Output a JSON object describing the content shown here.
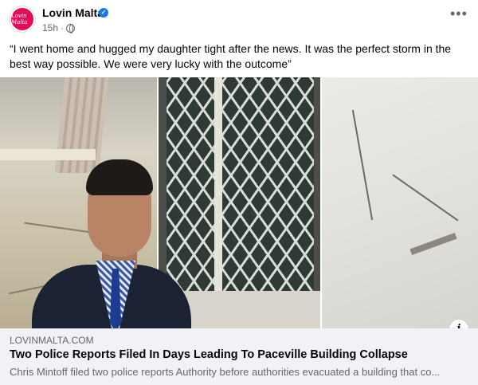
{
  "post": {
    "page_name": "Lovin Malta",
    "avatar_logo_text": "Lovin Malta",
    "time": "15h",
    "privacy_icon": "globe-icon",
    "more_icon": "more-options-icon",
    "caption": "“I went home and hugged my daughter tight after the news. It was the perfect storm in the best way possible. We were very lucky with the outcome”"
  },
  "images": [
    {
      "name": "damaged-room-image"
    },
    {
      "name": "broken-window-image"
    },
    {
      "name": "cracked-wall-image"
    }
  ],
  "link_preview": {
    "domain": "LOVINMALTA.COM",
    "title": "Two Police Reports Filed In Days Leading To Paceville Building Collapse",
    "description": "Chris Mintoff filed two police reports Authority before authorities evacuated a building that co...",
    "info_icon": "info-icon"
  },
  "colors": {
    "brand": "#e30b5c",
    "verified": "#1877f2",
    "secondary_text": "#65676b",
    "link_bg": "#f0f2f5"
  }
}
